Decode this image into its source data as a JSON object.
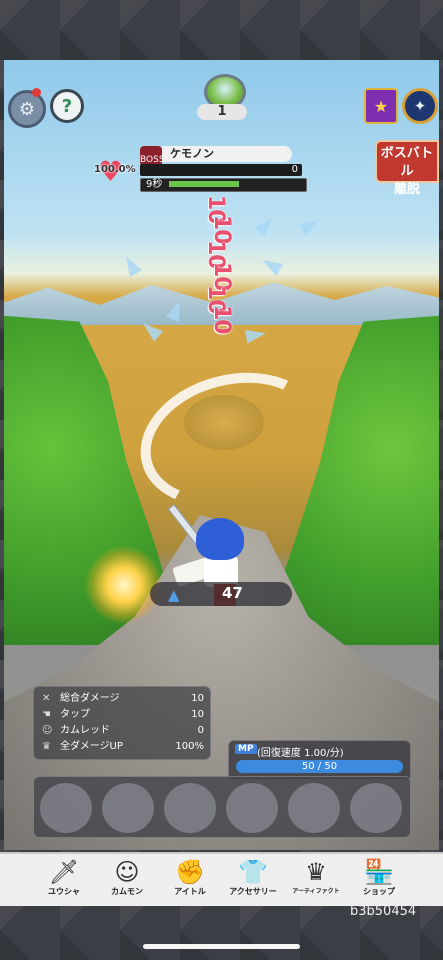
{
  "hud": {
    "stage_number": "1",
    "boss_exit_label_line1": "ボスバトル",
    "boss_exit_label_line2": "離脱"
  },
  "boss": {
    "tag": "BOSS",
    "name": "ケモノン",
    "hp_percent_text": "100.0%",
    "hp_value": "0",
    "timer_text": "9秒"
  },
  "damage_numbers": [
    "10",
    "10",
    "10",
    "10",
    "10",
    "10"
  ],
  "shard_counter": {
    "value": "47"
  },
  "stats": [
    {
      "icon": "swords-icon",
      "label": "総合ダメージ",
      "value": "10"
    },
    {
      "icon": "tap-icon",
      "label": "タップ",
      "value": "10"
    },
    {
      "icon": "people-icon",
      "label": "カムレッド",
      "value": "0"
    },
    {
      "icon": "crown-icon",
      "label": "全ダメージUP",
      "value": "100%"
    }
  ],
  "mp": {
    "badge": "MP",
    "regen_label": "(回復速度 1.00/分)",
    "value_text": "50 / 50"
  },
  "skill_slots": 6,
  "nav": [
    {
      "icon": "sword-icon",
      "glyph": "🗡",
      "label": "ユウシャ"
    },
    {
      "icon": "companion-icon",
      "glyph": "☺",
      "label": "カムモン"
    },
    {
      "icon": "fist-icon",
      "glyph": "✊",
      "label": "アイトル"
    },
    {
      "icon": "shirt-icon",
      "glyph": "👕",
      "label": "アクセサリー"
    },
    {
      "icon": "crown-icon",
      "glyph": "♛",
      "label": "アーティファクト"
    },
    {
      "icon": "shop-icon",
      "glyph": "🏪",
      "label": "ショップ"
    }
  ],
  "build_id": "b3b50454"
}
